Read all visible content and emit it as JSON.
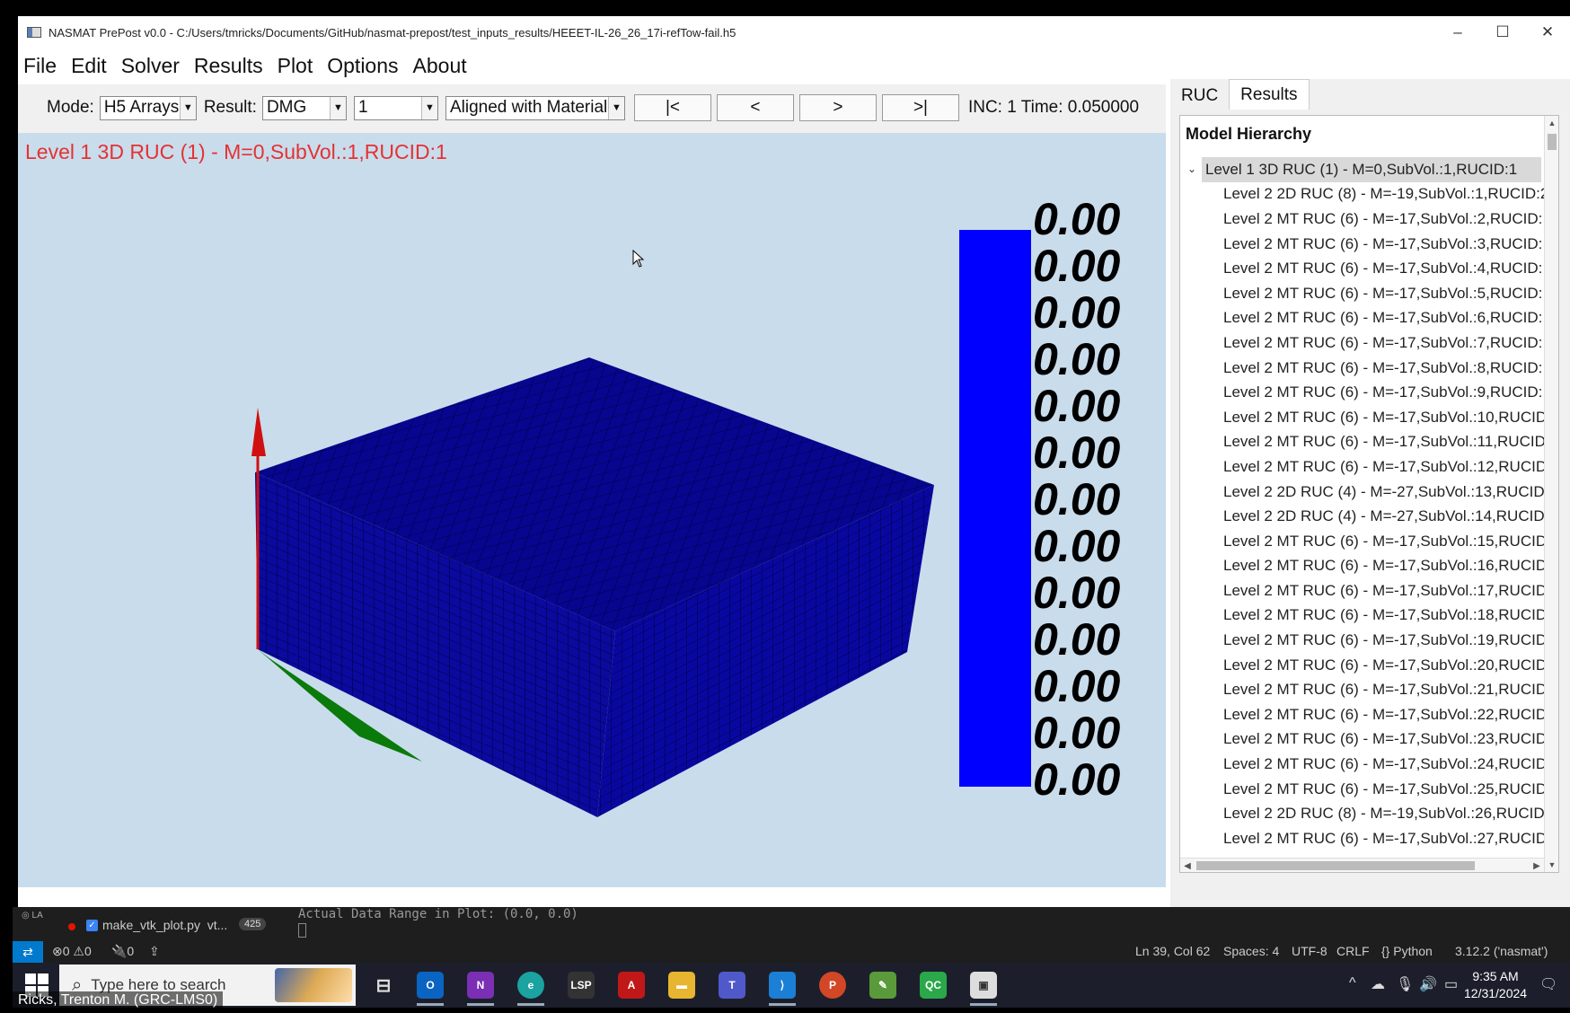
{
  "window": {
    "title": "NASMAT PrePost v0.0 - C:/Users/tmricks/Documents/GitHub/nasmat-prepost/test_inputs_results/HEEET-IL-26_26_17i-refTow-fail.h5",
    "minimize": "–",
    "maximize": "☐",
    "close": "✕"
  },
  "menu": [
    "File",
    "Edit",
    "Solver",
    "Results",
    "Plot",
    "Options",
    "About"
  ],
  "toolbar": {
    "mode_label": "Mode:",
    "mode_value": "H5 Arrays",
    "result_label": "Result:",
    "result_value": "DMG",
    "component_value": "1",
    "orientation_value": "Aligned with Material",
    "nav_first": "|<",
    "nav_prev": "<",
    "nav_next": ">",
    "nav_last": ">|",
    "inc_text": "INC: 1  Time: 0.050000"
  },
  "viewport": {
    "label": "Level 1 3D RUC (1) - M=0,SubVol.:1,RUCID:1",
    "background": "#c9dcec",
    "mesh_color": "#00008b",
    "colorbar_color": "#0000ff",
    "colorbar_values": [
      "0.00",
      "0.00",
      "0.00",
      "0.00",
      "0.00",
      "0.00",
      "0.00",
      "0.00",
      "0.00",
      "0.00",
      "0.00",
      "0.00",
      "0.00"
    ]
  },
  "right_panel": {
    "tabs": [
      "RUC",
      "Results"
    ],
    "active_tab": "Results",
    "tree_title": "Model Hierarchy",
    "root": "Level 1 3D RUC (1) - M=0,SubVol.:1,RUCID:1",
    "children": [
      "Level 2 2D RUC (8) - M=-19,SubVol.:1,RUCID:2",
      "Level 2 MT RUC (6) - M=-17,SubVol.:2,RUCID:",
      "Level 2 MT RUC (6) - M=-17,SubVol.:3,RUCID:",
      "Level 2 MT RUC (6) - M=-17,SubVol.:4,RUCID:",
      "Level 2 MT RUC (6) - M=-17,SubVol.:5,RUCID:",
      "Level 2 MT RUC (6) - M=-17,SubVol.:6,RUCID:",
      "Level 2 MT RUC (6) - M=-17,SubVol.:7,RUCID:",
      "Level 2 MT RUC (6) - M=-17,SubVol.:8,RUCID:",
      "Level 2 MT RUC (6) - M=-17,SubVol.:9,RUCID:",
      "Level 2 MT RUC (6) - M=-17,SubVol.:10,RUCID",
      "Level 2 MT RUC (6) - M=-17,SubVol.:11,RUCID",
      "Level 2 MT RUC (6) - M=-17,SubVol.:12,RUCID",
      "Level 2 2D RUC (4) - M=-27,SubVol.:13,RUCID",
      "Level 2 2D RUC (4) - M=-27,SubVol.:14,RUCID",
      "Level 2 MT RUC (6) - M=-17,SubVol.:15,RUCID",
      "Level 2 MT RUC (6) - M=-17,SubVol.:16,RUCID",
      "Level 2 MT RUC (6) - M=-17,SubVol.:17,RUCID",
      "Level 2 MT RUC (6) - M=-17,SubVol.:18,RUCID",
      "Level 2 MT RUC (6) - M=-17,SubVol.:19,RUCID",
      "Level 2 MT RUC (6) - M=-17,SubVol.:20,RUCID",
      "Level 2 MT RUC (6) - M=-17,SubVol.:21,RUCID",
      "Level 2 MT RUC (6) - M=-17,SubVol.:22,RUCID",
      "Level 2 MT RUC (6) - M=-17,SubVol.:23,RUCID",
      "Level 2 MT RUC (6) - M=-17,SubVol.:24,RUCID",
      "Level 2 MT RUC (6) - M=-17,SubVol.:25,RUCID",
      "Level 2 2D RUC (8) - M=-19,SubVol.:26,RUCID",
      "Level 2 MT RUC (6) - M=-17,SubVol.:27,RUCID"
    ]
  },
  "vscode": {
    "file": "make_vtk_plot.py",
    "file_suffix": "vt...",
    "badge": "425",
    "terminal_text": "Actual Data Range in Plot:  (0.0, 0.0)",
    "errors": "⊗0 ⚠0",
    "ports": "🔌0",
    "status_items": [
      "Ln 39, Col 62",
      "Spaces: 4",
      "UTF-8",
      "CRLF",
      "{} Python",
      "3.12.2 ('nasmat')"
    ]
  },
  "taskbar": {
    "search_placeholder": "Type here to search",
    "time": "9:35 AM",
    "date": "12/31/2024",
    "presenter": "Ricks, Trenton M. (GRC-LMS0)",
    "apps": [
      "task-view",
      "outlook",
      "onenote",
      "edge",
      "lsp",
      "acrobat",
      "file-explorer",
      "teams",
      "vscode",
      "powerpoint",
      "notepad",
      "qc",
      "nasmat"
    ]
  }
}
